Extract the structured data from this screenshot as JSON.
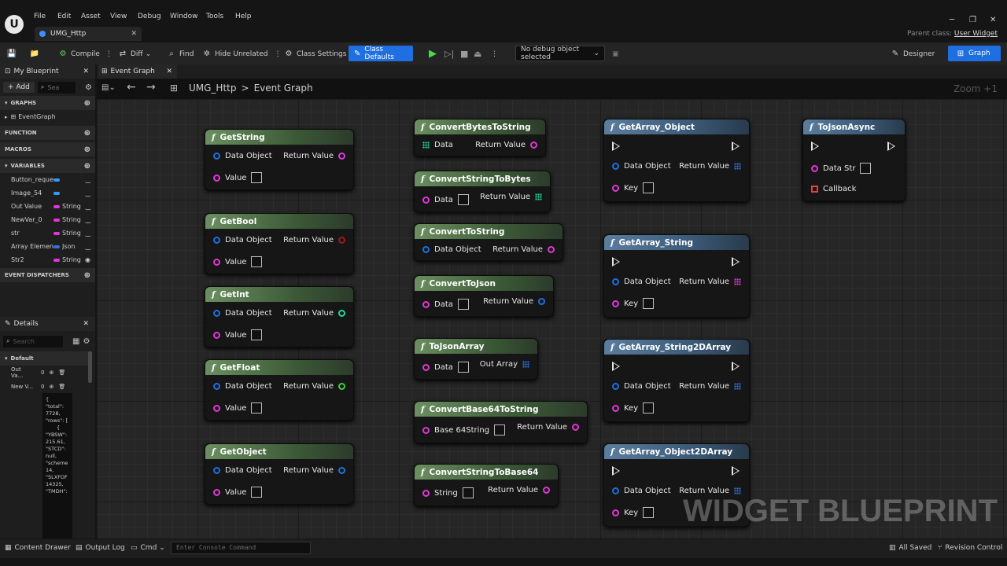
{
  "menu": [
    "File",
    "Edit",
    "Asset",
    "View",
    "Debug",
    "Window",
    "Tools",
    "Help"
  ],
  "doc_tab": "UMG_Http",
  "parent_class_label": "Parent class:",
  "parent_class_value": "User Widget",
  "toolbar": {
    "compile": "Compile",
    "diff": "Diff",
    "find": "Find",
    "hide_unrelated": "Hide Unrelated",
    "class_settings": "Class Settings",
    "class_defaults": "Class Defaults",
    "debug_object": "No debug object selected",
    "designer": "Designer",
    "graph": "Graph"
  },
  "left": {
    "tab": "My Blueprint",
    "add": "+ Add",
    "search_placeholder": "Sea",
    "graphs": "GRAPHS",
    "event_graph_item": "EventGraph",
    "functions": "FUNCTION",
    "macros": "MACROS",
    "variables": "VARIABLES",
    "event_dispatchers": "EVENT DISPATCHERS",
    "vars": [
      {
        "name": "Button_reque",
        "type": "",
        "color": "#2f9bff"
      },
      {
        "name": "Image_54",
        "type": "",
        "color": "#2f9bff"
      },
      {
        "name": "Out Value",
        "type": "String",
        "color": "#e236d8"
      },
      {
        "name": "NewVar_0",
        "type": "String",
        "color": "#e236d8"
      },
      {
        "name": "str",
        "type": "String",
        "color": "#e236d8"
      },
      {
        "name": "Array Elemen",
        "type": "Json",
        "color": "#2f6fe0"
      },
      {
        "name": "Str2",
        "type": "String",
        "color": "#e236d8"
      }
    ]
  },
  "details": {
    "tab": "Details",
    "search_placeholder": "Search",
    "section": "Default",
    "rows": [
      {
        "label": "Out Va...",
        "value": "0"
      },
      {
        "label": "New V...",
        "value": "0"
      }
    ],
    "json_text": [
      "{",
      "\"total\":",
      "7728,",
      "\"rows\": [",
      "{",
      "\"YBSW\":",
      "215.61,",
      "\"STCD\":",
      "null,",
      "\"scheme",
      "14,",
      "\"SLXFOF",
      "14325,",
      "\"TMDH\":"
    ]
  },
  "graph": {
    "tab": "Event Graph",
    "breadcrumb_root": "UMG_Http",
    "breadcrumb_sep": ">",
    "breadcrumb_leaf": "Event Graph",
    "zoom": "Zoom +1",
    "watermark": "WIDGET BLUEPRINT"
  },
  "nodes": {
    "getstring": {
      "title": "GetString",
      "in1": "Data Object",
      "out1": "Return Value",
      "in2": "Value"
    },
    "getbool": {
      "title": "GetBool",
      "in1": "Data Object",
      "out1": "Return Value",
      "in2": "Value"
    },
    "getint": {
      "title": "GetInt",
      "in1": "Data Object",
      "out1": "Return Value",
      "in2": "Value"
    },
    "getfloat": {
      "title": "GetFloat",
      "in1": "Data Object",
      "out1": "Return Value",
      "in2": "Value"
    },
    "getobject": {
      "title": "GetObject",
      "in1": "Data Object",
      "out1": "Return Value",
      "in2": "Value"
    },
    "convertbytestostring": {
      "title": "ConvertBytesToString",
      "in1": "Data",
      "out1": "Return Value"
    },
    "convertstringtobytes": {
      "title": "ConvertStringToBytes",
      "in1": "Data",
      "out1": "Return Value"
    },
    "converttostring": {
      "title": "ConvertToString",
      "in1": "Data Object",
      "out1": "Return Value"
    },
    "converttojson": {
      "title": "ConvertToJson",
      "in1": "Data",
      "out1": "Return Value"
    },
    "tojsonarray": {
      "title": "ToJsonArray",
      "in1": "Data",
      "out1": "Out Array"
    },
    "convertbase64tostring": {
      "title": "ConvertBase64ToString",
      "in1": "Base 64String",
      "out1": "Return Value"
    },
    "convertstringtobase64": {
      "title": "ConvertStringToBase64",
      "in1": "String",
      "out1": "Return Value"
    },
    "getarray_object": {
      "title": "GetArray_Object",
      "in1": "Data Object",
      "out1": "Return Value",
      "in2": "Key"
    },
    "getarray_string": {
      "title": "GetArray_String",
      "in1": "Data Object",
      "out1": "Return Value",
      "in2": "Key"
    },
    "getarray_string2darray": {
      "title": "GetArray_String2DArray",
      "in1": "Data Object",
      "out1": "Return Value",
      "in2": "Key"
    },
    "getarray_object2darray": {
      "title": "GetArray_Object2DArray",
      "in1": "Data Object",
      "out1": "Return Value",
      "in2": "Key"
    },
    "tojsonasync": {
      "title": "ToJsonAsync",
      "in1": "Data Str",
      "in2": "Callback"
    }
  },
  "status": {
    "content_drawer": "Content Drawer",
    "output_log": "Output Log",
    "cmd": "Cmd",
    "console_placeholder": "Enter Console Command",
    "all_saved": "All Saved",
    "revision_control": "Revision Control"
  },
  "colors": {
    "object_pin": "#1f6fe0",
    "string_pin": "#e236d8",
    "bool_pin": "#a01818",
    "int_pin": "#1fd6a0",
    "float_pin": "#3fcf3f",
    "array_pin": "#2f6fe0",
    "accent": "#1f6fe0"
  }
}
